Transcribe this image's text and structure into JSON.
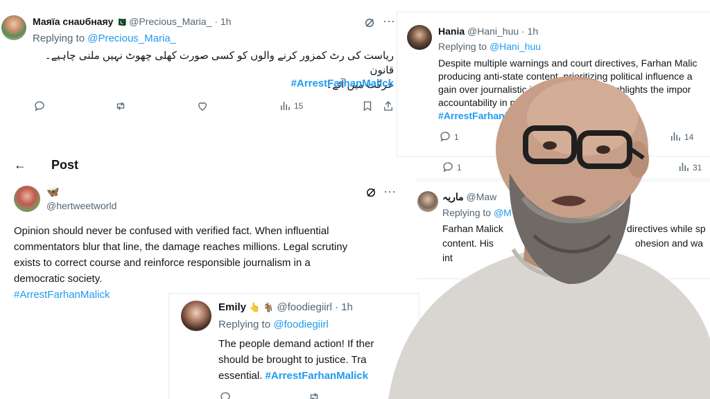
{
  "post1": {
    "name": "Маяїа ᴄнaυбнaяy",
    "flag": "🇵🇰",
    "handle": "@Precious_Maria_",
    "time": "· 1h",
    "replying_prefix": "Replying to",
    "replying_handle": "@Precious_Maria_",
    "text_line1": "ریاست کی رٹ کمزور کرنے والوں کو کسی صورت کھلی چھوٹ نہیں ملنی چاہیے۔ قانون",
    "text_line2": "حرکت میں آئے۔",
    "hashtag": "#ArrestFarhanMalick",
    "views": "15"
  },
  "post2": {
    "name": "Hania",
    "handle": "@Hani_huu",
    "time": "· 1h",
    "replying_prefix": "Replying to",
    "replying_handle": "@Hani_huu",
    "line1": "Despite multiple warnings and court directives, Farhan Malic",
    "line2": "producing anti-state content, prioritizing political influence a",
    "line3": "gain over journalistic integrity. This just highlights the impor",
    "line4": "accountability in media.",
    "hashtag": "#ArrestFarhanMalick",
    "replies": "1",
    "views": "14",
    "replies2": "1",
    "views2": "31"
  },
  "post3": {
    "header_back": "←",
    "header_title": "Post",
    "name_emoji": "🦋",
    "handle": "@hertweetworld",
    "line1": "Opinion should never be confused with verified fact. When influential",
    "line2": "commentators blur that line, the damage reaches millions. Legal scrutiny",
    "line3": "exists to correct course and reinforce responsible journalism in a",
    "line4": "democratic society.",
    "hashtag": "#ArrestFarhanMalick"
  },
  "post4": {
    "name": "Emily",
    "emojis": "👆 🐐",
    "handle": "@foodiegiirl",
    "time": "· 1h",
    "replying_prefix": "Replying to",
    "replying_handle": "@foodiegiirl",
    "line1": "The people demand action! If ther",
    "line2": "should be brought to justice. Tra",
    "line3_prefix": "essential.",
    "hashtag": "#ArrestFarhanMalick"
  },
  "post5": {
    "name": "ماریہ",
    "handle": "@Maw",
    "replying_prefix": "Replying to",
    "replying_handle": "@M",
    "line1": "Farhan Malick",
    "line1b": "directives while sp",
    "line2": "content. His",
    "line2b": "ohesion and wa",
    "line3": "int"
  },
  "colors": {
    "accent": "#1d9bf0",
    "text": "#0f1419",
    "muted": "#536471"
  }
}
